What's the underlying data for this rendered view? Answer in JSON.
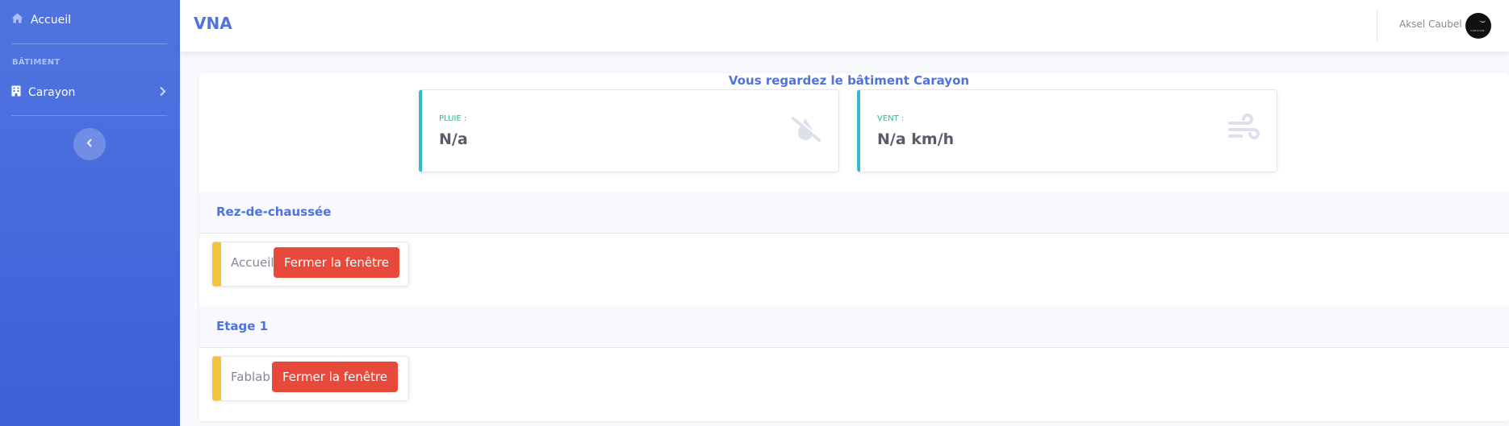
{
  "sidebar": {
    "home_label": "Accueil",
    "section_heading": "BÂTIMENT",
    "building_label": "Carayon",
    "icons": {
      "home": "home-icon",
      "building": "building-icon",
      "expand": "chevron-right-icon",
      "collapse": "chevron-left-icon"
    }
  },
  "topbar": {
    "brand": "VNA",
    "user_name": "Aksel Caubel",
    "avatar_text": "CARAYON"
  },
  "main": {
    "viewing_text": "Vous regardez le bâtiment Carayon",
    "stats": [
      {
        "label": "PLUIE :",
        "value": "N/a",
        "icon": "rain-off-icon"
      },
      {
        "label": "VENT :",
        "value": "N/a km/h",
        "icon": "wind-icon"
      }
    ],
    "floors": [
      {
        "title": "Rez-de-chaussée",
        "rooms": [
          {
            "name": "Accueil :",
            "button": "Fermer la fenêtre"
          }
        ]
      },
      {
        "title": "Etage 1",
        "rooms": [
          {
            "name": "Fablab :",
            "button": "Fermer la fenêtre"
          }
        ]
      }
    ]
  },
  "colors": {
    "sidebar": "#4e73df",
    "primary": "#4e73df",
    "info_border": "#36b9cc",
    "stat_label": "#1cc88a",
    "warning_border": "#f6c23e",
    "danger_button": "#e74a3b"
  }
}
